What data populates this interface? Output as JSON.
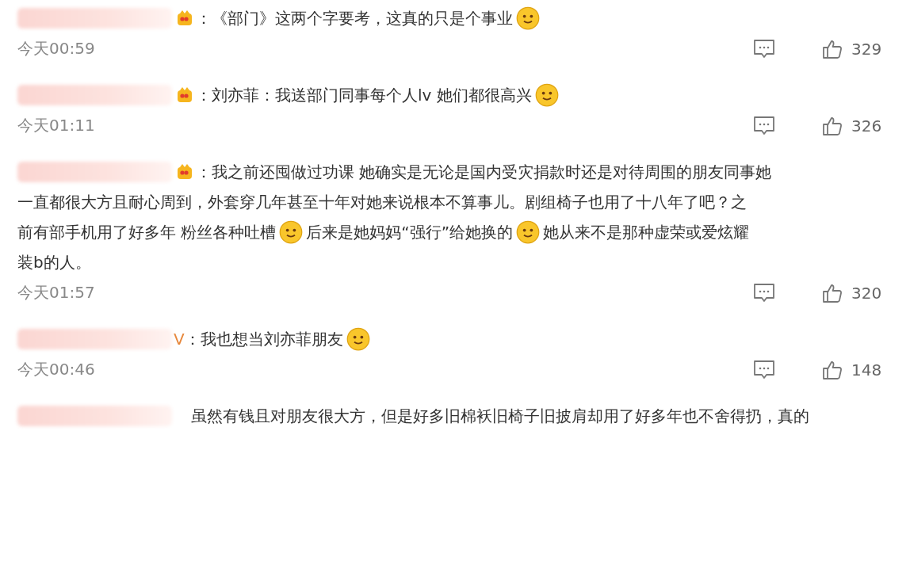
{
  "comments": [
    {
      "badge": true,
      "lines": [
        [
          {
            "kind": "text",
            "text": "：《部门》这两个字要考，这真的只是个事业"
          },
          {
            "kind": "emoji"
          }
        ]
      ],
      "time": "今天00:59",
      "likes": "329"
    },
    {
      "badge": true,
      "lines": [
        [
          {
            "kind": "text",
            "text": "：刘亦菲：我送部门同事每个人lv 她们都很高兴"
          },
          {
            "kind": "emoji"
          }
        ]
      ],
      "time": "今天01:11",
      "likes": "326"
    },
    {
      "badge": true,
      "lines": [
        [
          {
            "kind": "text",
            "text": "：我之前还囤做过功课 她确实是无论是国内受灾捐款时还是对待周围的朋友同事她"
          }
        ],
        [
          {
            "kind": "text",
            "text": "一直都很大方且耐心周到，外套穿几年甚至十年对她来说根本不算事儿。剧组椅子也用了十八年了吧？之"
          }
        ],
        [
          {
            "kind": "text",
            "text": "前有部手机用了好多年 粉丝各种吐槽"
          },
          {
            "kind": "emoji"
          },
          {
            "kind": "text",
            "text": "后来是她妈妈“强行”给她换的"
          },
          {
            "kind": "emoji"
          },
          {
            "kind": "text",
            "text": "她从来不是那种虚荣或爱炫耀"
          }
        ],
        [
          {
            "kind": "text",
            "text": "装b的人。"
          }
        ]
      ],
      "time": "今天01:57",
      "likes": "320"
    },
    {
      "badge": false,
      "name_suffix": "V",
      "lines": [
        [
          {
            "kind": "text",
            "text": "：我也想当刘亦菲朋友"
          },
          {
            "kind": "emoji"
          }
        ]
      ],
      "time": "今天00:46",
      "likes": "148"
    },
    {
      "badge": false,
      "lines": [
        [
          {
            "kind": "text",
            "text": "虽然有钱且对朋友很大方，但是好多旧棉袄旧椅子旧披肩却用了好多年也不舍得扔，真的"
          }
        ]
      ]
    }
  ]
}
